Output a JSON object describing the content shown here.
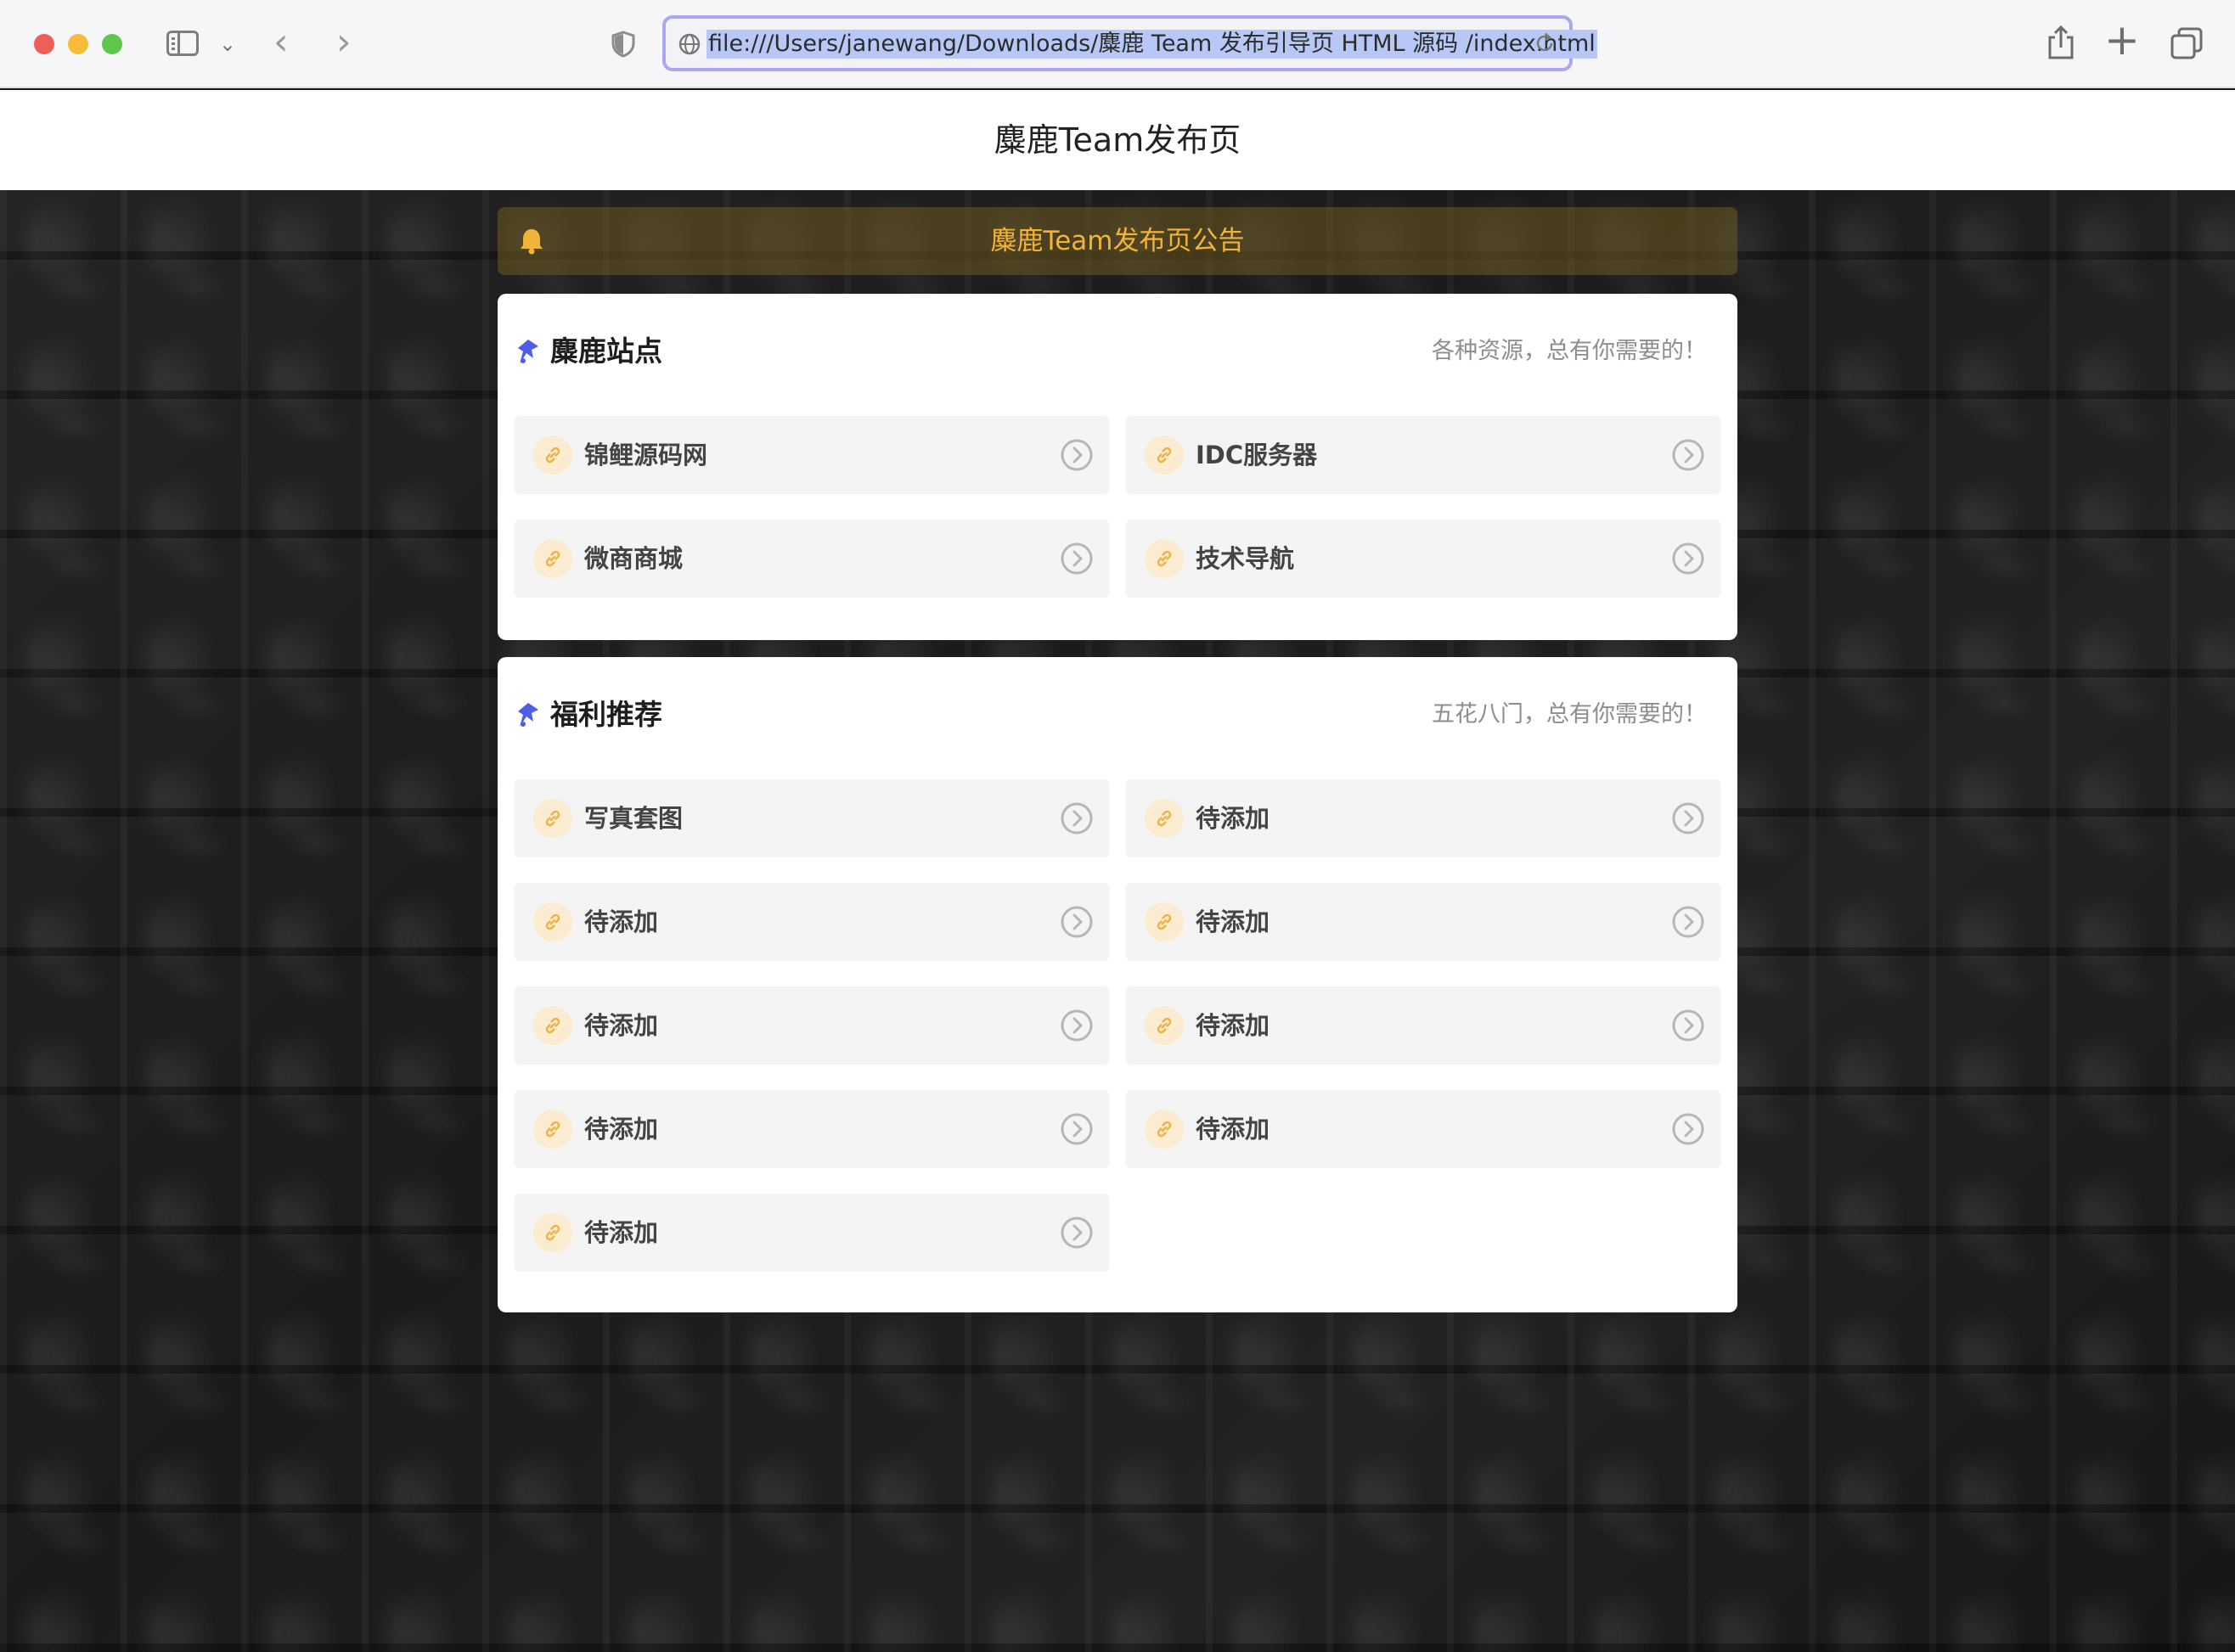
{
  "browser": {
    "url": "file:///Users/janewang/Downloads/麋鹿 Team 发布引导页 HTML 源码 /index.html"
  },
  "page": {
    "header_title": "麋鹿Team发布页",
    "notice": "麋鹿Team发布页公告"
  },
  "sections": [
    {
      "title": "麋鹿站点",
      "subtitle": "各种资源，总有你需要的！",
      "items": [
        {
          "label": "锦鲤源码网"
        },
        {
          "label": "IDC服务器"
        },
        {
          "label": "微商商城"
        },
        {
          "label": "技术导航"
        }
      ]
    },
    {
      "title": "福利推荐",
      "subtitle": "五花八门，总有你需要的！",
      "items": [
        {
          "label": "写真套图"
        },
        {
          "label": "待添加"
        },
        {
          "label": "待添加"
        },
        {
          "label": "待添加"
        },
        {
          "label": "待添加"
        },
        {
          "label": "待添加"
        },
        {
          "label": "待添加"
        },
        {
          "label": "待添加"
        },
        {
          "label": "待添加"
        }
      ]
    }
  ],
  "colors": {
    "notice_text": "#f1b33a",
    "link_icon": "#f0b23c",
    "pin_icon": "#4f5ee8"
  },
  "icons": {
    "item_leading": "link-icon",
    "item_trailing": "chevron-right-circle-icon",
    "section_heading": "pin-icon",
    "notice": "bell-icon"
  }
}
